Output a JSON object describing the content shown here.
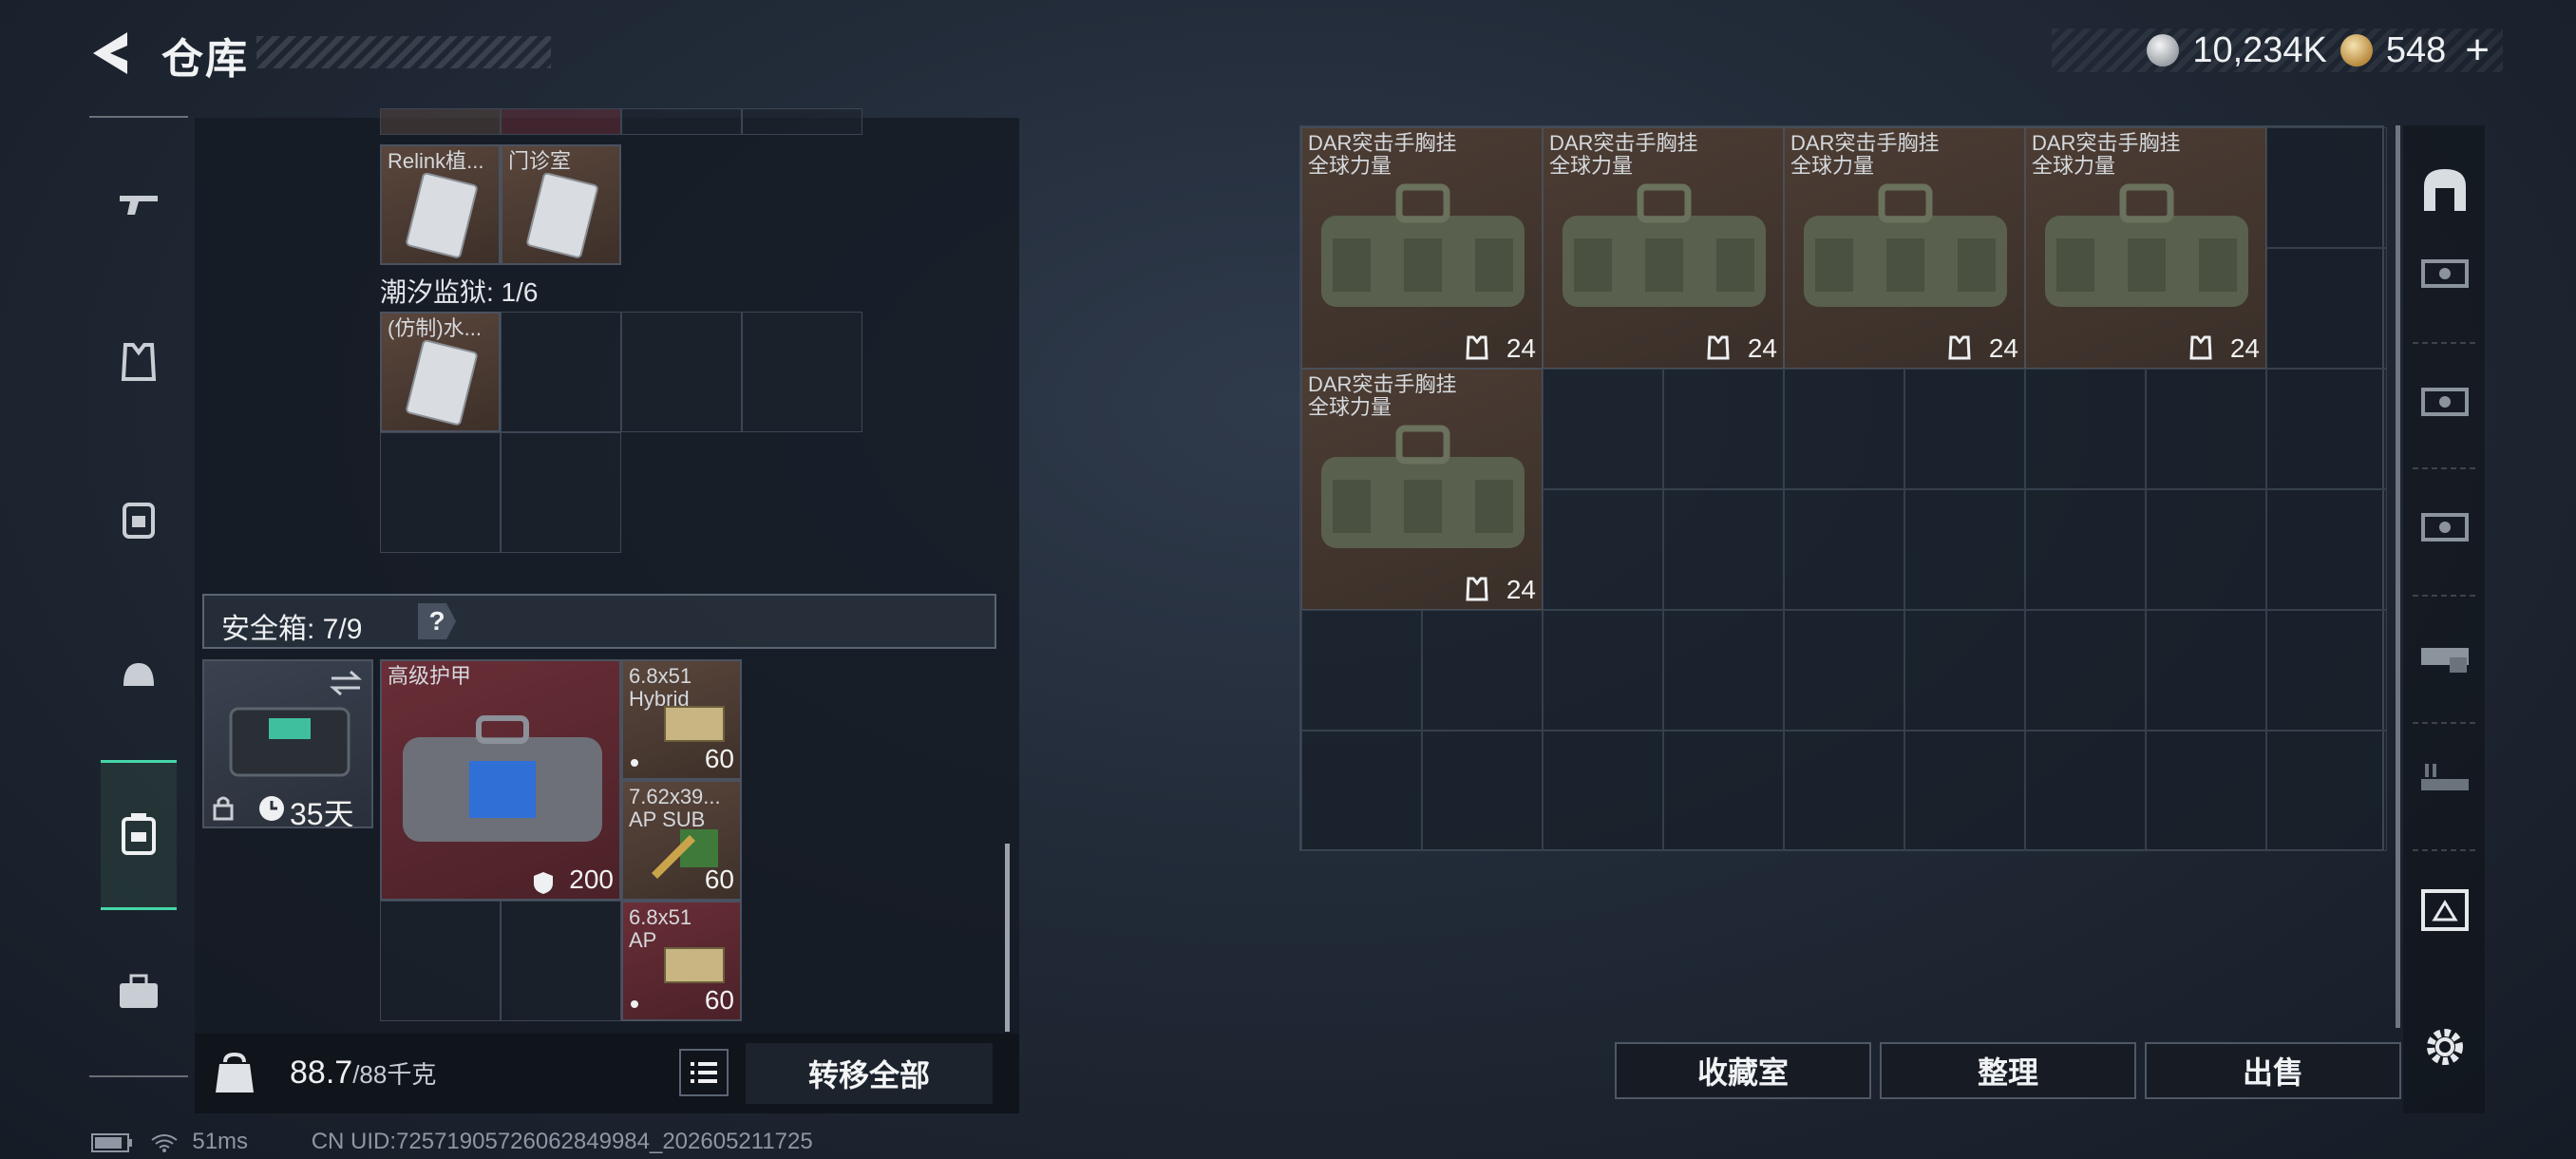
{
  "header": {
    "title": "仓库"
  },
  "currency": {
    "silver": "10,234K",
    "gold": "548",
    "plus": "+"
  },
  "left_panel": {
    "top_items": [
      {
        "name": "Relink植...",
        "bg": "brown"
      },
      {
        "name": "门诊室",
        "bg": "brown"
      }
    ],
    "prison": {
      "label": "潮汐监狱: 1/6",
      "items": [
        {
          "name": "(仿制)水..."
        }
      ]
    },
    "safebox": {
      "label": "安全箱: 7/9",
      "help": "?",
      "days": "35天"
    },
    "items": [
      {
        "name": "高级护甲",
        "count": "200"
      },
      {
        "name": "6.8x51\nHybrid",
        "count": "60"
      },
      {
        "name": "7.62x39...\nAP SUB",
        "count": "60"
      },
      {
        "name": "6.8x51\nAP",
        "count": "60"
      }
    ],
    "weight": {
      "current": "88.7",
      "max": "/88千克"
    },
    "transfer_all": "转移全部"
  },
  "storage": {
    "bags": [
      {
        "name": "DAR突击手胸挂\n全球力量",
        "count": "24"
      },
      {
        "name": "DAR突击手胸挂\n全球力量",
        "count": "24"
      },
      {
        "name": "DAR突击手胸挂\n全球力量",
        "count": "24"
      },
      {
        "name": "DAR突击手胸挂\n全球力量",
        "count": "24"
      },
      {
        "name": "DAR突击手胸挂\n全球力量",
        "count": "24"
      }
    ],
    "buttons": {
      "collection": "收藏室",
      "organize": "整理",
      "sell": "出售"
    }
  },
  "footer": {
    "ping": "51ms",
    "uid": "CN UID:7257190572606284998​4_202605211725"
  }
}
